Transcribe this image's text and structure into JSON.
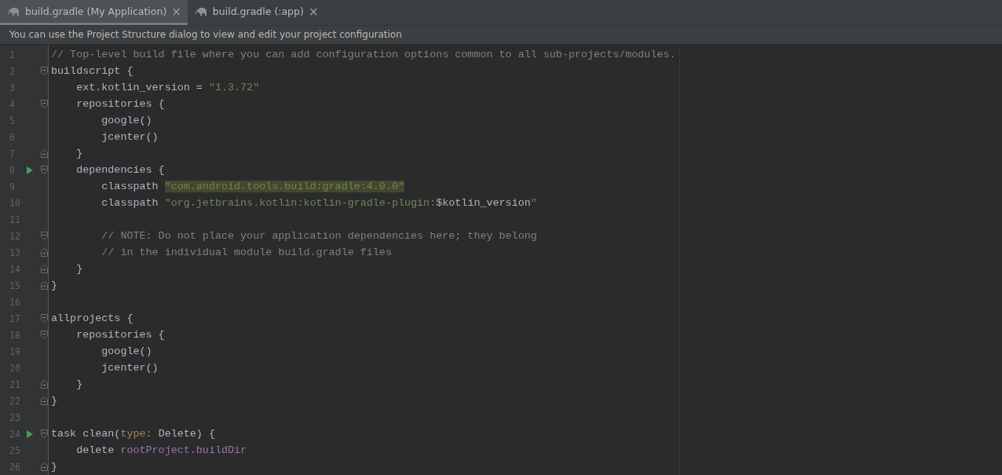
{
  "tabs": [
    {
      "label": "build.gradle (My Application)",
      "close": "×",
      "selected": true
    },
    {
      "label": "build.gradle (:app)",
      "close": "×",
      "selected": false
    }
  ],
  "banner": "You can use the Project Structure dialog to view and edit your project configuration",
  "lines": [
    {
      "number": "1",
      "run": false,
      "fold_start": false,
      "fold_end": false,
      "segments": [
        {
          "text": "// Top-level build file where you can add configuration options common to all sub-projects/modules.",
          "kind": "comment"
        }
      ]
    },
    {
      "number": "2",
      "run": false,
      "fold_start": true,
      "fold_end": false,
      "segments": [
        {
          "text": "buildscript {",
          "kind": "plain"
        }
      ]
    },
    {
      "number": "3",
      "run": false,
      "fold_start": false,
      "fold_end": false,
      "segments": [
        {
          "text": "    ext.kotlin_version = ",
          "kind": "plain"
        },
        {
          "text": "\"1.3.72\"",
          "kind": "string"
        }
      ]
    },
    {
      "number": "4",
      "run": false,
      "fold_start": true,
      "fold_end": false,
      "segments": [
        {
          "text": "    repositories {",
          "kind": "plain"
        }
      ]
    },
    {
      "number": "5",
      "run": false,
      "fold_start": false,
      "fold_end": false,
      "segments": [
        {
          "text": "        google()",
          "kind": "plain"
        }
      ]
    },
    {
      "number": "6",
      "run": false,
      "fold_start": false,
      "fold_end": false,
      "segments": [
        {
          "text": "        jcenter()",
          "kind": "plain"
        }
      ]
    },
    {
      "number": "7",
      "run": false,
      "fold_start": false,
      "fold_end": true,
      "segments": [
        {
          "text": "    }",
          "kind": "plain"
        }
      ]
    },
    {
      "number": "8",
      "run": true,
      "fold_start": true,
      "fold_end": false,
      "segments": [
        {
          "text": "    dependencies {",
          "kind": "plain"
        }
      ]
    },
    {
      "number": "9",
      "run": false,
      "fold_start": false,
      "fold_end": false,
      "segments": [
        {
          "text": "        classpath ",
          "kind": "plain"
        },
        {
          "text": "\"com.android.tools.build:gradle:4.0.0\"",
          "kind": "highlight"
        }
      ]
    },
    {
      "number": "10",
      "run": false,
      "fold_start": false,
      "fold_end": false,
      "segments": [
        {
          "text": "        classpath ",
          "kind": "plain"
        },
        {
          "text": "\"org.jetbrains.kotlin:kotlin-gradle-plugin:",
          "kind": "string"
        },
        {
          "text": "$kotlin_version",
          "kind": "plain"
        },
        {
          "text": "\"",
          "kind": "string"
        }
      ]
    },
    {
      "number": "11",
      "run": false,
      "fold_start": false,
      "fold_end": false
    },
    {
      "number": "12",
      "run": false,
      "fold_start": true,
      "fold_end": false,
      "segments": [
        {
          "text": "        // NOTE: Do not place your application dependencies here; they belong",
          "kind": "comment"
        }
      ]
    },
    {
      "number": "13",
      "run": false,
      "fold_start": false,
      "fold_end": true,
      "segments": [
        {
          "text": "        // in the individual module build.gradle files",
          "kind": "comment"
        }
      ]
    },
    {
      "number": "14",
      "run": false,
      "fold_start": false,
      "fold_end": true,
      "segments": [
        {
          "text": "    }",
          "kind": "plain"
        }
      ]
    },
    {
      "number": "15",
      "run": false,
      "fold_start": false,
      "fold_end": true,
      "segments": [
        {
          "text": "}",
          "kind": "plain"
        }
      ]
    },
    {
      "number": "16",
      "run": false,
      "fold_start": false,
      "fold_end": false
    },
    {
      "number": "17",
      "run": false,
      "fold_start": true,
      "fold_end": false,
      "segments": [
        {
          "text": "allprojects {",
          "kind": "plain"
        }
      ]
    },
    {
      "number": "18",
      "run": false,
      "fold_start": true,
      "fold_end": false,
      "segments": [
        {
          "text": "    repositories {",
          "kind": "plain"
        }
      ]
    },
    {
      "number": "19",
      "run": false,
      "fold_start": false,
      "fold_end": false,
      "segments": [
        {
          "text": "        google()",
          "kind": "plain"
        }
      ]
    },
    {
      "number": "20",
      "run": false,
      "fold_start": false,
      "fold_end": false,
      "segments": [
        {
          "text": "        jcenter()",
          "kind": "plain"
        }
      ]
    },
    {
      "number": "21",
      "run": false,
      "fold_start": false,
      "fold_end": true,
      "segments": [
        {
          "text": "    }",
          "kind": "plain"
        }
      ]
    },
    {
      "number": "22",
      "run": false,
      "fold_start": false,
      "fold_end": true,
      "segments": [
        {
          "text": "}",
          "kind": "plain"
        }
      ]
    },
    {
      "number": "23",
      "run": false,
      "fold_start": false,
      "fold_end": false
    },
    {
      "number": "24",
      "run": true,
      "fold_start": true,
      "fold_end": false,
      "segments": [
        {
          "text": "task clean(",
          "kind": "plain"
        },
        {
          "text": "type:",
          "kind": "keyword"
        },
        {
          "text": " Delete) {",
          "kind": "plain"
        }
      ]
    },
    {
      "number": "25",
      "run": false,
      "fold_start": false,
      "fold_end": false,
      "segments": [
        {
          "text": "    delete ",
          "kind": "plain"
        },
        {
          "text": "rootProject.buildDir",
          "kind": "field"
        }
      ]
    },
    {
      "number": "26",
      "run": false,
      "fold_start": false,
      "fold_end": true,
      "segments": [
        {
          "text": "}",
          "kind": "plain"
        }
      ]
    }
  ]
}
